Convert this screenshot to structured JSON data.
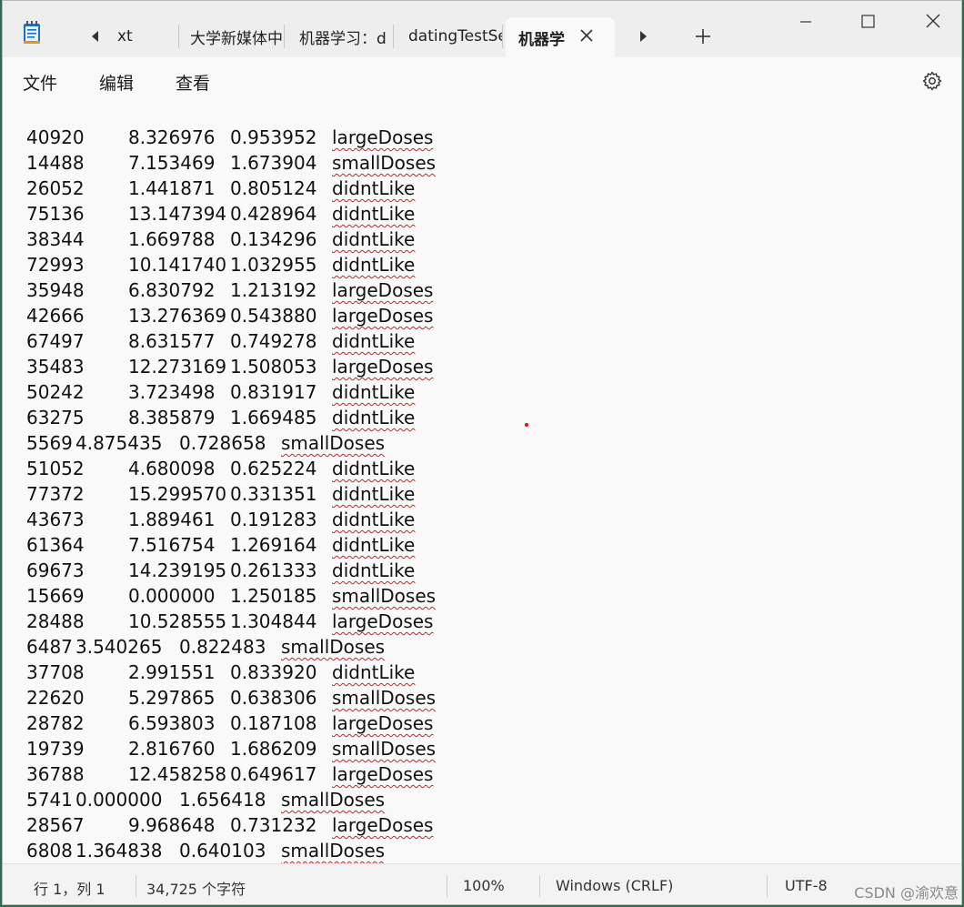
{
  "tabs": [
    {
      "label": "xt"
    },
    {
      "label": "大学新媒体中"
    },
    {
      "label": "机器学习：d"
    },
    {
      "label": "datingTestSe"
    },
    {
      "label": "机器学"
    }
  ],
  "menu": {
    "file": "文件",
    "edit": "编辑",
    "view": "查看"
  },
  "rows": [
    {
      "a": "40920",
      "b": "8.326976",
      "c": "0.953952",
      "d": "largeDoses"
    },
    {
      "a": "14488",
      "b": "7.153469",
      "c": "1.673904",
      "d": "smallDoses"
    },
    {
      "a": "26052",
      "b": "1.441871",
      "c": "0.805124",
      "d": "didntLike"
    },
    {
      "a": "75136",
      "b": "13.147394",
      "c": "0.428964",
      "d": "didntLike"
    },
    {
      "a": "38344",
      "b": "1.669788",
      "c": "0.134296",
      "d": "didntLike"
    },
    {
      "a": "72993",
      "b": "10.141740",
      "c": "1.032955",
      "d": "didntLike"
    },
    {
      "a": "35948",
      "b": "6.830792",
      "c": "1.213192",
      "d": "largeDoses"
    },
    {
      "a": "42666",
      "b": "13.276369",
      "c": "0.543880",
      "d": "largeDoses"
    },
    {
      "a": "67497",
      "b": "8.631577",
      "c": "0.749278",
      "d": "didntLike"
    },
    {
      "a": "35483",
      "b": "12.273169",
      "c": "1.508053",
      "d": "largeDoses"
    },
    {
      "a": "50242",
      "b": "3.723498",
      "c": "0.831917",
      "d": "didntLike"
    },
    {
      "a": "63275",
      "b": "8.385879",
      "c": "1.669485",
      "d": "didntLike"
    },
    {
      "a": "5569",
      "b": "4.875435",
      "c": "0.728658",
      "d": "smallDoses",
      "short": true
    },
    {
      "a": "51052",
      "b": "4.680098",
      "c": "0.625224",
      "d": "didntLike"
    },
    {
      "a": "77372",
      "b": "15.299570",
      "c": "0.331351",
      "d": "didntLike"
    },
    {
      "a": "43673",
      "b": "1.889461",
      "c": "0.191283",
      "d": "didntLike"
    },
    {
      "a": "61364",
      "b": "7.516754",
      "c": "1.269164",
      "d": "didntLike"
    },
    {
      "a": "69673",
      "b": "14.239195",
      "c": "0.261333",
      "d": "didntLike"
    },
    {
      "a": "15669",
      "b": "0.000000",
      "c": "1.250185",
      "d": "smallDoses"
    },
    {
      "a": "28488",
      "b": "10.528555",
      "c": "1.304844",
      "d": "largeDoses"
    },
    {
      "a": "6487",
      "b": "3.540265",
      "c": "0.822483",
      "d": "smallDoses",
      "short": true
    },
    {
      "a": "37708",
      "b": "2.991551",
      "c": "0.833920",
      "d": "didntLike"
    },
    {
      "a": "22620",
      "b": "5.297865",
      "c": "0.638306",
      "d": "smallDoses"
    },
    {
      "a": "28782",
      "b": "6.593803",
      "c": "0.187108",
      "d": "largeDoses"
    },
    {
      "a": "19739",
      "b": "2.816760",
      "c": "1.686209",
      "d": "smallDoses"
    },
    {
      "a": "36788",
      "b": "12.458258",
      "c": "0.649617",
      "d": "largeDoses"
    },
    {
      "a": "5741",
      "b": "0.000000",
      "c": "1.656418",
      "d": "smallDoses",
      "short": true
    },
    {
      "a": "28567",
      "b": "9.968648",
      "c": "0.731232",
      "d": "largeDoses"
    },
    {
      "a": "6808",
      "b": "1.364838",
      "c": "0.640103",
      "d": "smallDoses",
      "short": true
    }
  ],
  "status": {
    "position": "行 1，列 1",
    "chars": "34,725 个字符",
    "zoom": "100%",
    "line_ending": "Windows (CRLF)",
    "encoding": "UTF-8"
  },
  "watermark": "CSDN @渝欢意"
}
